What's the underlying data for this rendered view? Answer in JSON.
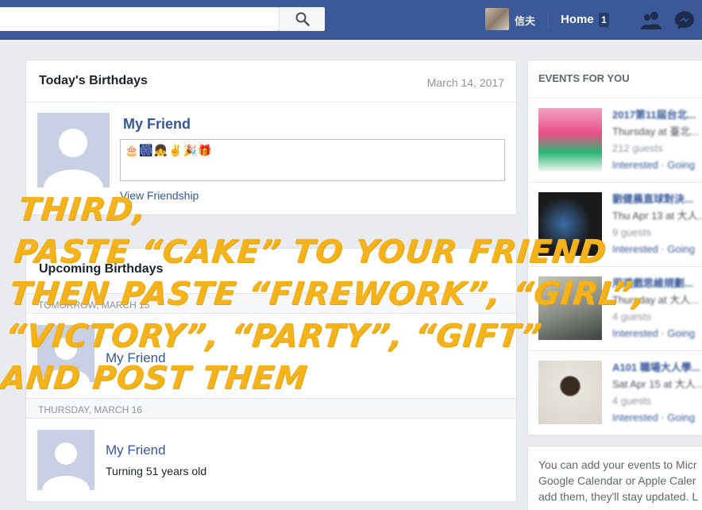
{
  "topbar": {
    "user_name": "信夫",
    "home_label": "Home",
    "home_count": "1",
    "icons": [
      "search-icon",
      "friends-icon",
      "messenger-icon"
    ]
  },
  "todays_birthdays": {
    "title": "Today's Birthdays",
    "date": "March 14, 2017",
    "friend_name": "My Friend",
    "message_emojis": "🎂🎆👧✌🎉🎁",
    "view_friendship": "View Friendship"
  },
  "upcoming": {
    "title": "Upcoming Birthdays",
    "groups": [
      {
        "header": "TOMORROW, MARCH 15",
        "friend": "My Friend"
      },
      {
        "header": "THURSDAY, MARCH 16",
        "friend": "My Friend",
        "detail": "Turning 51 years old"
      }
    ]
  },
  "events": {
    "title": "EVENTS FOR YOU",
    "items": [
      {
        "name": "2017第11屆台北...",
        "when": "Thursday at 臺北...",
        "guests": "212 guests",
        "actions": "Interested · Going",
        "thumb_color": "#e94f86"
      },
      {
        "name": "劉健晨直球對決...",
        "when": "Thu Apr 13 at 大人...",
        "guests": "9 guests",
        "actions": "Interested · Going",
        "thumb_color": "#1a1a1a"
      },
      {
        "name": "用遊戲思維規劃...",
        "when": "Thursday at 大人...",
        "guests": "4 guests",
        "actions": "Interested · Going",
        "thumb_color": "#8a8f86"
      },
      {
        "name": "A101 職場大人學...",
        "when": "Sat Apr 15 at 大人...",
        "guests": "4 guests",
        "actions": "Interested · Going",
        "thumb_color": "#d9d4cc"
      }
    ]
  },
  "sync": {
    "lines": [
      "You can add your events to Micr",
      "Google Calendar or Apple Caler",
      "add them, they'll stay updated. L"
    ]
  },
  "overlay": {
    "lines": [
      "Third,",
      "Paste “cake” to your friend",
      "then paste “firework”, “girl”,",
      "“victory”, “party”, “gift”",
      "and post them"
    ]
  },
  "colors": {
    "brand": "#3b5998",
    "link": "#365899",
    "overlay": "#f4b31c"
  }
}
